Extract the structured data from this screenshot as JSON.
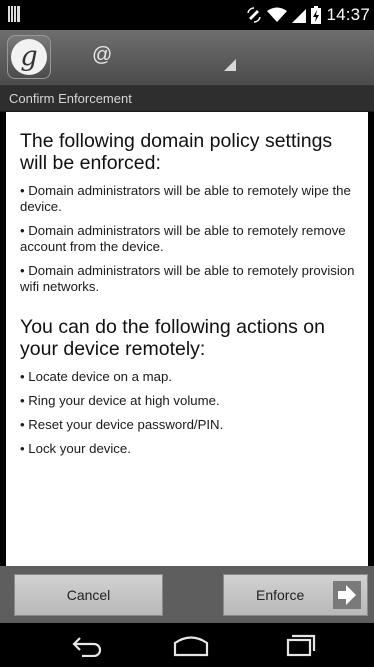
{
  "status_bar": {
    "time": "14:37"
  },
  "action_bar": {
    "app_icon_letter": "g",
    "account_label": "@"
  },
  "section_header": {
    "title": "Confirm Enforcement"
  },
  "content": {
    "policies_heading": "The following domain policy settings will be enforced:",
    "policies": [
      "• Domain administrators will be able to remotely wipe the device.",
      "• Domain administrators will be able to remotely remove account from the device.",
      "• Domain administrators will be able to remotely provision wifi networks."
    ],
    "actions_heading": "You can do the following actions on your device remotely:",
    "actions": [
      "• Locate device on a map.",
      "• Ring your device at high volume.",
      "• Reset your device password/PIN.",
      "• Lock your device."
    ]
  },
  "buttons": {
    "cancel_label": "Cancel",
    "enforce_label": "Enforce"
  },
  "icons": {
    "back": "back-icon",
    "home": "home-icon",
    "recents": "recents-icon"
  }
}
